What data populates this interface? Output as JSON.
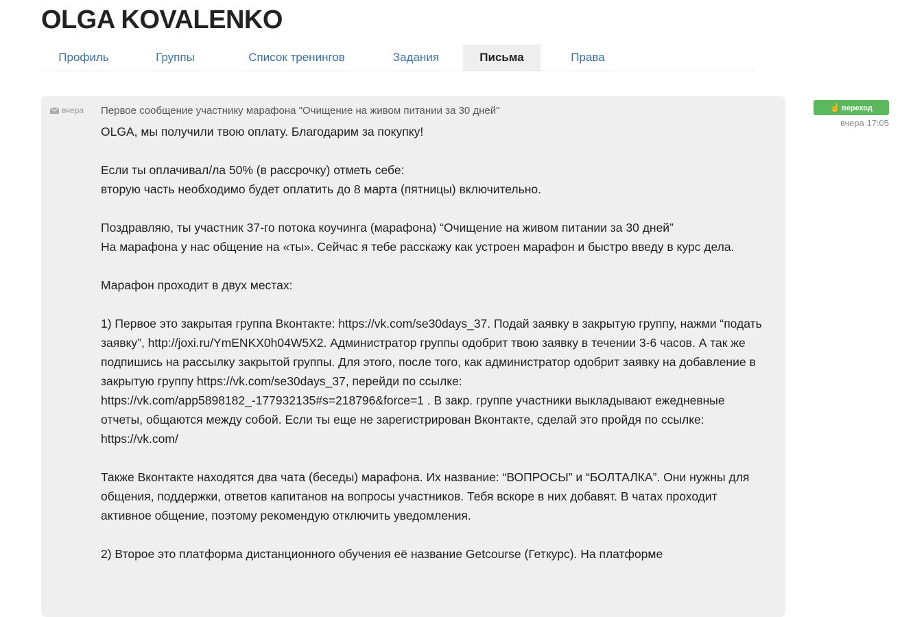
{
  "header": {
    "title": "OLGA KOVALENKO"
  },
  "tabs": [
    {
      "label": "Профиль"
    },
    {
      "label": "Группы"
    },
    {
      "label": "Список тренингов"
    },
    {
      "label": "Задания"
    },
    {
      "label": "Письма",
      "active": true
    },
    {
      "label": "Права"
    }
  ],
  "message": {
    "meta_time": "вчера",
    "subject": "Первое сообщение участнику марафона \"Очищение на живом питании за 30 дней\"",
    "paragraphs": [
      "OLGA, мы получили твою оплату. Благодарим за покупку!",
      "Если ты оплачивал/ла 50% (в рассрочку) отметь себе:\nвторую часть необходимо будет оплатить до 8 марта (пятницы) включительно.",
      "Поздравляю, ты участник 37-го потока коучинга (марафона) “Очищение на живом питании за 30 дней”\nНа марафона у нас общение на «ты». Сейчас я тебе расскажу как устроен марафон и быстро введу в курс дела.",
      "Марафон проходит в двух местах:",
      "1) Первое это закрытая группа Вконтакте: https://vk.com/se30days_37. Подай заявку в закрытую группу, нажми “подать заявку”, http://joxi.ru/YmENKX0h04W5X2. Администратор группы одобрит твою заявку в течении 3-6 часов. А так же подпишись на рассылку закрытой группы. Для этого, после того, как администратор одобрит заявку на добавление в закрытую группу https://vk.com/se30days_37, перейди по ссылке: https://vk.com/app5898182_-177932135#s=218796&force=1 . В закр. группе участники выкладывают ежедневные отчеты, общаются между собой. Если ты еще не зарегистрирован Вконтакте, сделай это пройдя по ссылке: https://vk.com/",
      "Также Вконтакте находятся два чата (беседы) марафона. Их название: “ВОПРОСЫ” и “БОЛТАЛКА”. Они нужны для общения, поддержки, ответов капитанов на вопросы участников. Тебя вскоре в них добавят. В чатах проходит активное общение, поэтому рекомендую отключить уведомления.",
      "2) Второе это платформа дистанционного обучения её название Getcourse (Геткурс). На платформе"
    ]
  },
  "side": {
    "button_label": "переход",
    "button_icon": "pointing-hand-icon",
    "timestamp": "вчера 17:05",
    "button_color": "#5cb85c"
  }
}
